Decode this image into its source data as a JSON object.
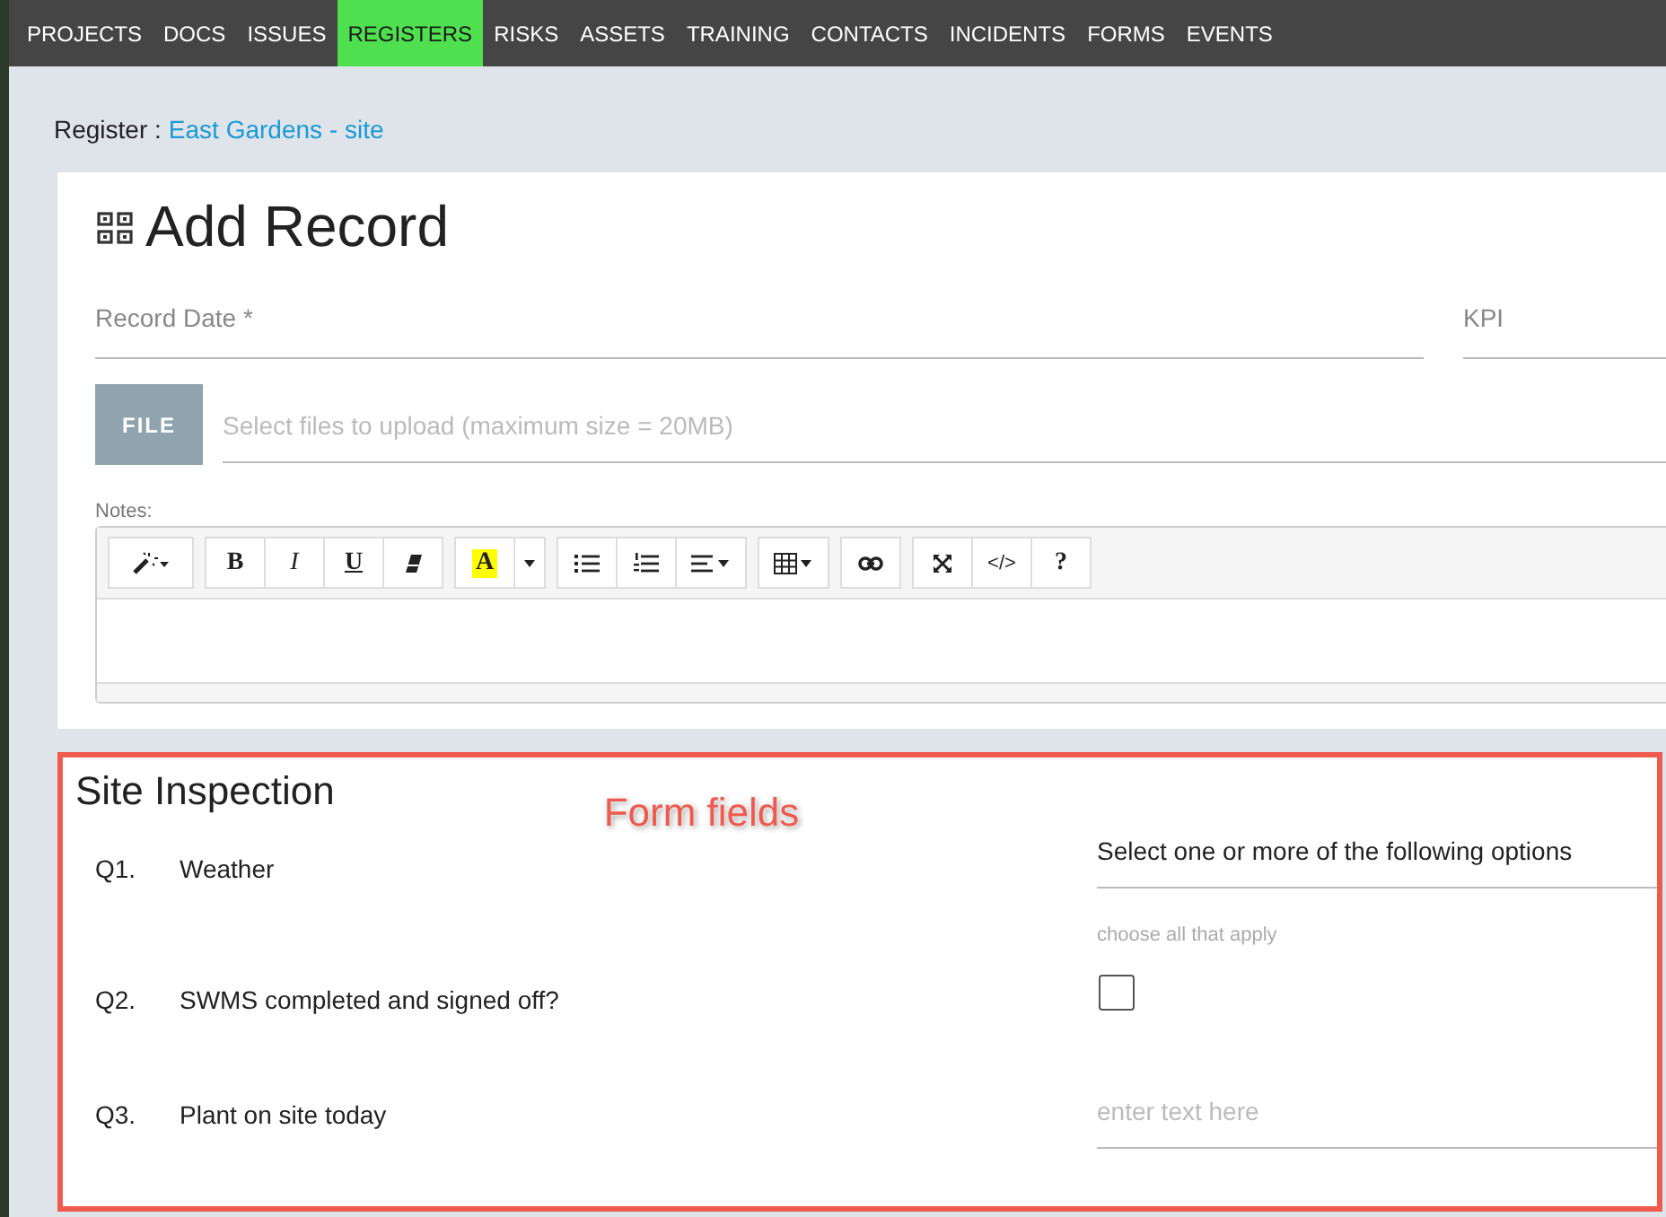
{
  "nav": [
    {
      "label": "PROJECTS",
      "selected": false
    },
    {
      "label": "DOCS",
      "selected": false
    },
    {
      "label": "ISSUES",
      "selected": false
    },
    {
      "label": "REGISTERS",
      "selected": true
    },
    {
      "label": "RISKS",
      "selected": false
    },
    {
      "label": "ASSETS",
      "selected": false
    },
    {
      "label": "TRAINING",
      "selected": false
    },
    {
      "label": "CONTACTS",
      "selected": false
    },
    {
      "label": "INCIDENTS",
      "selected": false
    },
    {
      "label": "FORMS",
      "selected": false
    },
    {
      "label": "EVENTS",
      "selected": false
    }
  ],
  "breadcrumb": {
    "label": "Register :",
    "link": "East Gardens - site"
  },
  "title": "Add Record",
  "fields": [
    {
      "label": "Record Date *"
    },
    {
      "label": "KPI"
    }
  ],
  "upload": {
    "button": "FILE",
    "placeholder": "Select files to upload (maximum size = 20MB)"
  },
  "notes": {
    "label": "Notes:",
    "toolbar": [
      [
        {
          "kind": "magic"
        }
      ],
      [
        {
          "kind": "bold",
          "label": "B"
        },
        {
          "kind": "italic",
          "label": "I"
        },
        {
          "kind": "underline",
          "label": "U"
        },
        {
          "kind": "eraser"
        }
      ],
      [
        {
          "kind": "highlight",
          "label": "A"
        },
        {
          "kind": "caret"
        }
      ],
      [
        {
          "kind": "bullets"
        },
        {
          "kind": "numbers"
        },
        {
          "kind": "align"
        }
      ],
      [
        {
          "kind": "table"
        }
      ],
      [
        {
          "kind": "link"
        }
      ],
      [
        {
          "kind": "fullscreen"
        },
        {
          "kind": "code",
          "label": "</>"
        },
        {
          "kind": "help",
          "label": "?"
        }
      ]
    ]
  },
  "section": {
    "title": "Site Inspection",
    "annotation": "Form fields",
    "questions": [
      {
        "number": "Q1.",
        "label": "Weather",
        "kind": "select",
        "value": "Select one or more of the following options",
        "hint": "choose all that apply"
      },
      {
        "number": "Q2.",
        "label": "SWMS completed and signed off?",
        "kind": "checkbox",
        "checked": false
      },
      {
        "number": "Q3.",
        "label": "Plant on site today",
        "kind": "text",
        "placeholder": "enter text here"
      }
    ]
  }
}
